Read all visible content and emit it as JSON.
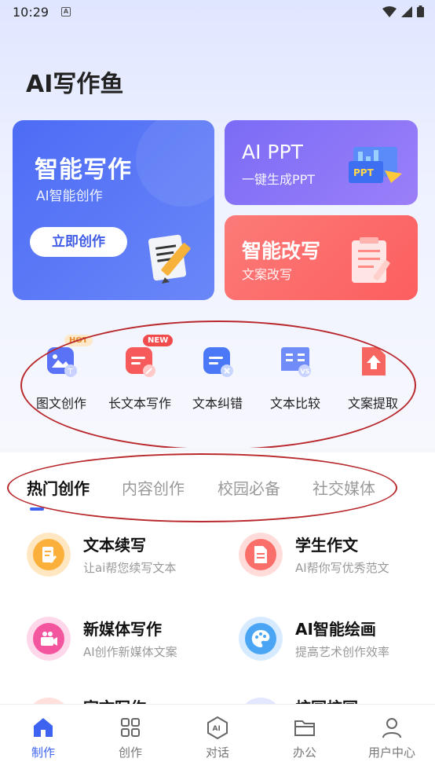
{
  "status": {
    "time": "10:29",
    "badge": "A"
  },
  "app": {
    "title": "AI写作鱼"
  },
  "cards": {
    "write": {
      "title": "智能写作",
      "subtitle": "AI智能创作",
      "button": "立即创作"
    },
    "ppt": {
      "title": "AI PPT",
      "subtitle": "一键生成PPT",
      "badge": "PPT"
    },
    "rewrite": {
      "title": "智能改写",
      "subtitle": "文案改写"
    }
  },
  "tools": [
    {
      "label": "图文创作",
      "tag": "HOT",
      "icon": "image-text-icon"
    },
    {
      "label": "长文本写作",
      "tag": "NEW",
      "icon": "long-text-icon"
    },
    {
      "label": "文本纠错",
      "tag": "",
      "icon": "text-correction-icon"
    },
    {
      "label": "文本比较",
      "tag": "",
      "icon": "text-compare-icon"
    },
    {
      "label": "文案提取",
      "tag": "",
      "icon": "copy-extract-icon"
    }
  ],
  "tabs": [
    "热门创作",
    "内容创作",
    "校园必备",
    "社交媒体"
  ],
  "features": [
    {
      "title": "文本续写",
      "desc": "让ai帮您续写文本",
      "color": "#fbb03b"
    },
    {
      "title": "学生作文",
      "desc": "AI帮你写优秀范文",
      "color": "#fb6f6a"
    },
    {
      "title": "新媒体写作",
      "desc": "AI创作新媒体文案",
      "color": "#f4559f"
    },
    {
      "title": "AI智能绘画",
      "desc": "提高艺术创作效率",
      "color": "#4aa6f5"
    }
  ],
  "partial": [
    "宣文写作",
    "校园校园"
  ],
  "nav": [
    {
      "label": "制作",
      "icon": "home-icon",
      "active": true
    },
    {
      "label": "创作",
      "icon": "grid-icon",
      "active": false
    },
    {
      "label": "对话",
      "icon": "ai-chat-icon",
      "active": false
    },
    {
      "label": "办公",
      "icon": "folder-icon",
      "active": false
    },
    {
      "label": "用户中心",
      "icon": "user-icon",
      "active": false
    }
  ],
  "colors": {
    "accent": "#3d63f0",
    "write_card": "#4d6cf5",
    "ppt_card": "#8a76f7",
    "rewrite_card": "#fd6a68"
  }
}
